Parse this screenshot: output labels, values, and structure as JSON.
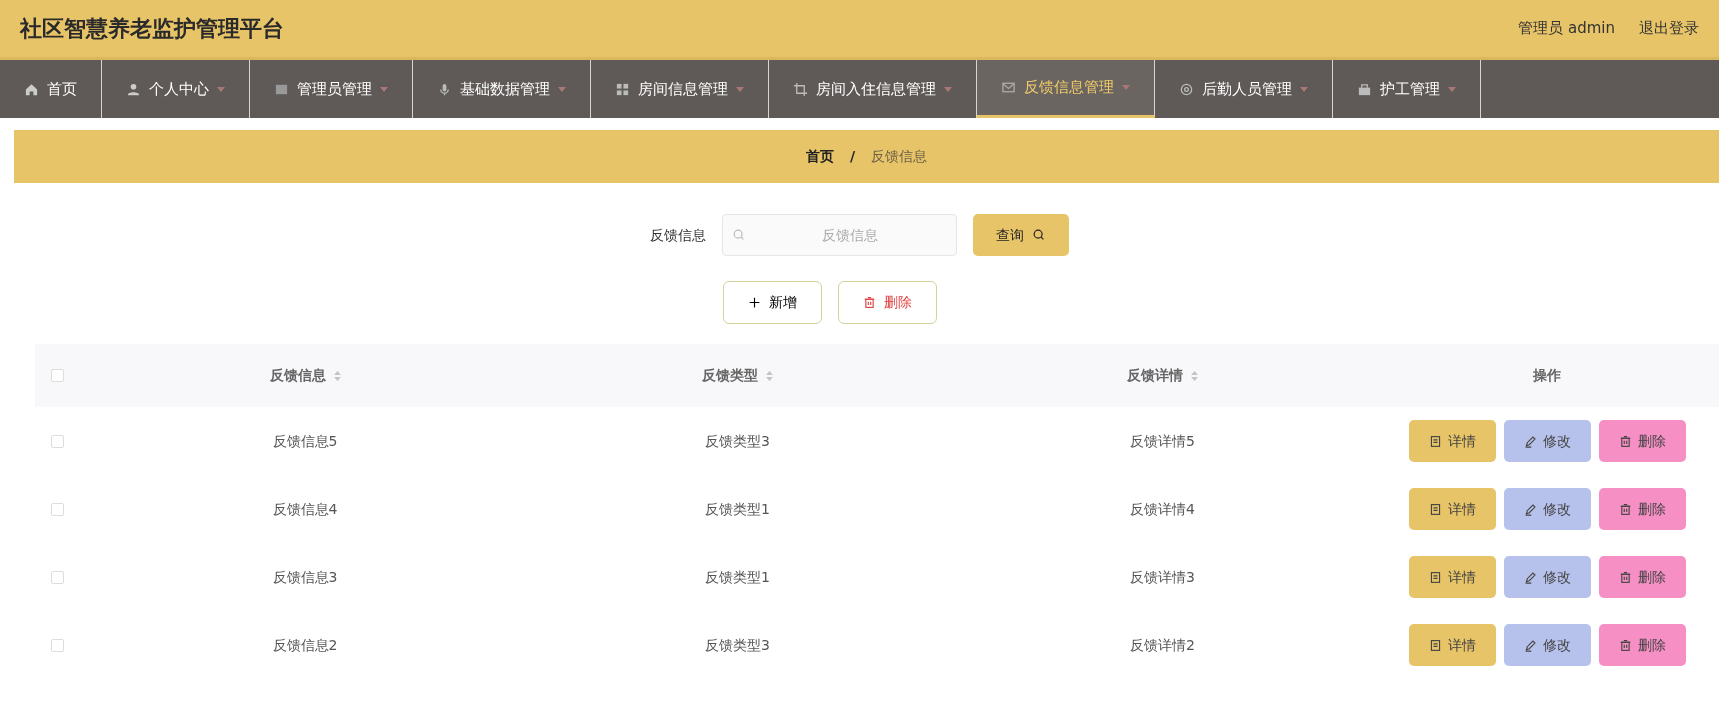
{
  "header": {
    "title": "社区智慧养老监护管理平台",
    "user": "管理员 admin",
    "logout": "退出登录"
  },
  "nav": [
    {
      "label": "首页",
      "selected": false,
      "dropdown": false
    },
    {
      "label": "个人中心",
      "selected": false,
      "dropdown": true
    },
    {
      "label": "管理员管理",
      "selected": false,
      "dropdown": true
    },
    {
      "label": "基础数据管理",
      "selected": false,
      "dropdown": true
    },
    {
      "label": "房间信息管理",
      "selected": false,
      "dropdown": true
    },
    {
      "label": "房间入住信息管理",
      "selected": false,
      "dropdown": true
    },
    {
      "label": "反馈信息管理",
      "selected": true,
      "dropdown": true
    },
    {
      "label": "后勤人员管理",
      "selected": false,
      "dropdown": true
    },
    {
      "label": "护工管理",
      "selected": false,
      "dropdown": true
    }
  ],
  "breadcrumb": [
    {
      "label": "首页",
      "current": false
    },
    {
      "label": "反馈信息",
      "current": true
    }
  ],
  "breadcrumb_separator": "/",
  "search": {
    "label": "反馈信息",
    "placeholder": "反馈信息",
    "button": "查询"
  },
  "toolbar": [
    {
      "kind": "add",
      "label": "新增"
    },
    {
      "kind": "delete",
      "label": "删除"
    }
  ],
  "table": {
    "columns": [
      {
        "label": "反馈信息",
        "sortable": true
      },
      {
        "label": "反馈类型",
        "sortable": true
      },
      {
        "label": "反馈详情",
        "sortable": true
      },
      {
        "label": "操作",
        "sortable": false
      }
    ],
    "select_all": {
      "checked": false
    },
    "rows": [
      {
        "checked": false,
        "cells": [
          "反馈信息5",
          "反馈类型3",
          "反馈详情5"
        ],
        "actions": [
          {
            "kind": "detail",
            "label": "详情"
          },
          {
            "kind": "edit",
            "label": "修改"
          },
          {
            "kind": "delete",
            "label": "删除"
          }
        ]
      },
      {
        "checked": false,
        "cells": [
          "反馈信息4",
          "反馈类型1",
          "反馈详情4"
        ],
        "actions": [
          {
            "kind": "detail",
            "label": "详情"
          },
          {
            "kind": "edit",
            "label": "修改"
          },
          {
            "kind": "delete",
            "label": "删除"
          }
        ]
      },
      {
        "checked": false,
        "cells": [
          "反馈信息3",
          "反馈类型1",
          "反馈详情3"
        ],
        "actions": [
          {
            "kind": "detail",
            "label": "详情"
          },
          {
            "kind": "edit",
            "label": "修改"
          },
          {
            "kind": "delete",
            "label": "删除"
          }
        ]
      },
      {
        "checked": false,
        "cells": [
          "反馈信息2",
          "反馈类型3",
          "反馈详情2"
        ],
        "actions": [
          {
            "kind": "detail",
            "label": "详情"
          },
          {
            "kind": "edit",
            "label": "修改"
          },
          {
            "kind": "delete",
            "label": "删除"
          }
        ]
      }
    ]
  }
}
